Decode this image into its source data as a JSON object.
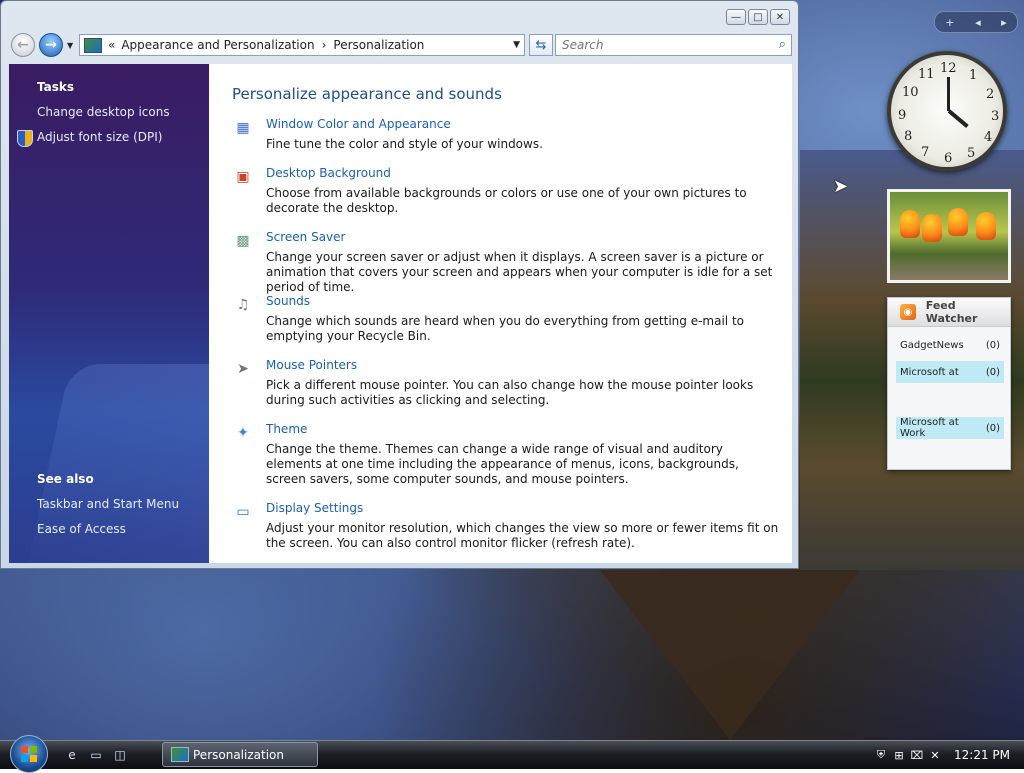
{
  "window": {
    "breadcrumb_chevron": "«",
    "breadcrumb": [
      "Appearance and Personalization",
      "Personalization"
    ],
    "breadcrumb_sep": "›",
    "search_placeholder": "Search",
    "caption": {
      "minimize": "—",
      "maximize": "□",
      "close": "✕"
    }
  },
  "sidebar": {
    "tasks_heading": "Tasks",
    "tasks": [
      "Change desktop icons",
      "Adjust font size (DPI)"
    ],
    "see_also_heading": "See also",
    "see_also": [
      "Taskbar and Start Menu",
      "Ease of Access"
    ]
  },
  "content": {
    "title": "Personalize appearance and sounds",
    "items": [
      {
        "title": "Window Color and Appearance",
        "desc": "Fine tune the color and style of your windows.",
        "icon": "window-color-icon",
        "glyph": "▦",
        "color": "#3f6fd2"
      },
      {
        "title": "Desktop Background",
        "desc": "Choose from available backgrounds or colors or use one of your own pictures to decorate the desktop.",
        "icon": "desktop-background-icon",
        "glyph": "▣",
        "color": "#c8452f"
      },
      {
        "title": "Screen Saver",
        "desc": "Change your screen saver or adjust when it displays. A screen saver is a picture or animation that covers your screen and appears when your computer is idle for a set period of time.",
        "icon": "screen-saver-icon",
        "glyph": "▩",
        "color": "#6a9c7b"
      },
      {
        "title": "Sounds",
        "desc": "Change which sounds are heard when you do everything from getting e-mail to emptying your Recycle Bin.",
        "icon": "sounds-icon",
        "glyph": "♫",
        "color": "#6d7790"
      },
      {
        "title": "Mouse Pointers",
        "desc": "Pick a different mouse pointer. You can also change how the mouse pointer looks during such activities as clicking and selecting.",
        "icon": "mouse-pointer-icon",
        "glyph": "➤",
        "color": "#707680"
      },
      {
        "title": "Theme",
        "desc": "Change the theme. Themes can change a wide range of visual and auditory elements at one time including the appearance of menus, icons, backgrounds, screen savers, some computer sounds, and mouse pointers.",
        "icon": "theme-icon",
        "glyph": "✦",
        "color": "#3a86d6"
      },
      {
        "title": "Display Settings",
        "desc": "Adjust your monitor resolution, which changes the view so more or fewer items fit on the screen. You can also control monitor flicker (refresh rate).",
        "icon": "display-settings-icon",
        "glyph": "▭",
        "color": "#2f79c9"
      }
    ]
  },
  "gadgets": {
    "toolbar": {
      "add": "+",
      "prev": "◂",
      "next": "▸"
    },
    "clock_numbers": [
      "12",
      "1",
      "2",
      "3",
      "4",
      "5",
      "6",
      "7",
      "8",
      "9",
      "10",
      "11"
    ],
    "feed": {
      "title": "Feed Watcher",
      "rss_glyph": "◉",
      "items": [
        {
          "name": "GadgetNews",
          "count": "(0)",
          "highlight": false
        },
        {
          "name": "Microsoft at",
          "count": "(0)",
          "highlight": true
        },
        {
          "name": "Microsoft at Work",
          "count": "(0)",
          "highlight": true
        }
      ]
    }
  },
  "taskbar": {
    "task_label": "Personalization",
    "quicklaunch": [
      {
        "name": "ie-icon",
        "glyph": "e"
      },
      {
        "name": "show-desktop-icon",
        "glyph": "▭"
      },
      {
        "name": "switch-windows-icon",
        "glyph": "◫"
      }
    ],
    "tray": [
      {
        "name": "security-shield-icon",
        "glyph": "⛨"
      },
      {
        "name": "windows-update-icon",
        "glyph": "⊞"
      },
      {
        "name": "network-icon",
        "glyph": "⌧"
      },
      {
        "name": "volume-muted-icon",
        "glyph": "✕"
      }
    ],
    "clock": "12:21 PM"
  }
}
